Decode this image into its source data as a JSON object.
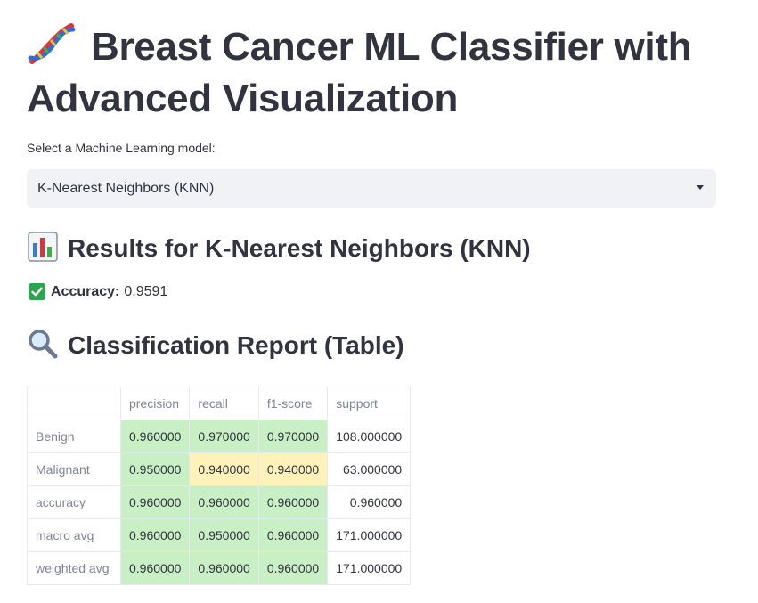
{
  "page": {
    "title": "Breast Cancer ML Classifier with Advanced Visualization",
    "title_icon": "dna-icon"
  },
  "model_select": {
    "label": "Select a Machine Learning model:",
    "value": "K-Nearest Neighbors (KNN)"
  },
  "results": {
    "heading": "Results for K-Nearest Neighbors (KNN)",
    "heading_icon": "bar-chart-icon",
    "accuracy_label": "Accuracy:",
    "accuracy_value": "0.9591",
    "accuracy_icon": "check-mark-icon"
  },
  "report": {
    "heading": "Classification Report (Table)",
    "heading_icon": "magnifying-glass-icon",
    "columns": [
      "precision",
      "recall",
      "f1-score",
      "support"
    ],
    "rows": [
      {
        "label": "Benign",
        "values": [
          "0.960000",
          "0.970000",
          "0.970000",
          "108.000000"
        ],
        "colors": [
          "#c8f0c4",
          "#c8f0c4",
          "#c8f0c4",
          "#ffffff"
        ]
      },
      {
        "label": "Malignant",
        "values": [
          "0.950000",
          "0.940000",
          "0.940000",
          "63.000000"
        ],
        "colors": [
          "#c8f0c4",
          "#fff2b8",
          "#fff2b8",
          "#ffffff"
        ]
      },
      {
        "label": "accuracy",
        "values": [
          "0.960000",
          "0.960000",
          "0.960000",
          "0.960000"
        ],
        "colors": [
          "#c8f0c4",
          "#c8f0c4",
          "#c8f0c4",
          "#ffffff"
        ]
      },
      {
        "label": "macro avg",
        "values": [
          "0.960000",
          "0.950000",
          "0.960000",
          "171.000000"
        ],
        "colors": [
          "#c8f0c4",
          "#c8f0c4",
          "#c8f0c4",
          "#ffffff"
        ]
      },
      {
        "label": "weighted avg",
        "values": [
          "0.960000",
          "0.960000",
          "0.960000",
          "171.000000"
        ],
        "colors": [
          "#c8f0c4",
          "#c8f0c4",
          "#c8f0c4",
          "#ffffff"
        ]
      }
    ]
  }
}
